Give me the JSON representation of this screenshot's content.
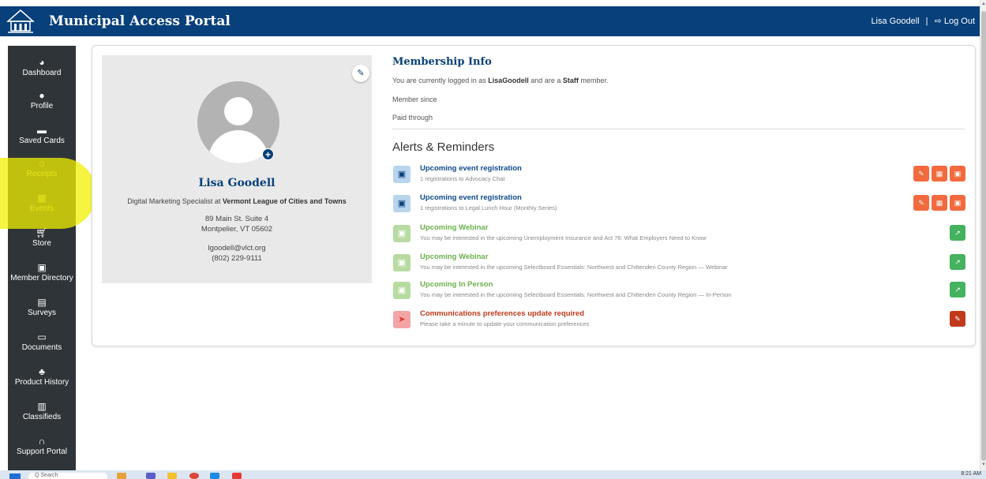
{
  "header": {
    "title": "Municipal Access Portal",
    "user_name": "Lisa Goodell",
    "separator": "|",
    "logout_label": "Log Out"
  },
  "sidebar": {
    "items": [
      {
        "label": "Dashboard",
        "icon": "dashboard-icon"
      },
      {
        "label": "Profile",
        "icon": "user-icon"
      },
      {
        "label": "Saved Cards",
        "icon": "card-icon"
      },
      {
        "label": "Receipts",
        "icon": "bank-icon"
      },
      {
        "label": "Events",
        "icon": "calendar-icon"
      },
      {
        "label": "Store",
        "icon": "cart-icon"
      },
      {
        "label": "Member Directory",
        "icon": "contact-icon"
      },
      {
        "label": "Surveys",
        "icon": "survey-icon"
      },
      {
        "label": "Documents",
        "icon": "folder-icon"
      },
      {
        "label": "Product History",
        "icon": "cubes-icon"
      },
      {
        "label": "Classifieds",
        "icon": "newspaper-icon"
      },
      {
        "label": "Support Portal",
        "icon": "headset-icon"
      }
    ]
  },
  "profile": {
    "name": "Lisa Goodell",
    "title_prefix": "Digital Marketing Specialist at",
    "organization": "Vermont League of Cities and Towns",
    "address_line1": "89 Main St. Suite 4",
    "address_line2": "Montpelier, VT 05602",
    "email": "lgoodell@vlct.org",
    "phone": "(802) 229-9111"
  },
  "membership": {
    "title": "Membership Info",
    "logged_in_prefix": "You are currently logged in as",
    "username": "LisaGoodell",
    "logged_in_mid": "and are a",
    "member_type": "Staff",
    "logged_in_suffix": "member.",
    "member_since_label": "Member since",
    "paid_through_label": "Paid through"
  },
  "alerts": {
    "title": "Alerts & Reminders",
    "items": [
      {
        "title": "Upcoming event registration",
        "subtitle": "1 registrations to Advocacy Chat"
      },
      {
        "title": "Upcoming event registration",
        "subtitle": "1 registrations to Legal Lunch Hour (Monthly Series)"
      },
      {
        "title": "Upcoming Webinar",
        "subtitle": "You may be interested in the upcoming Unemployment Insurance and Act 76: What Employers Need to Know"
      },
      {
        "title": "Upcoming Webinar",
        "subtitle": "You may be interested in the upcoming Selectboard Essentials: Northwest and Chittenden County Region — Webinar"
      },
      {
        "title": "Upcoming In Person",
        "subtitle": "You may be interested in the upcoming Selectboard Essentials: Northwest and Chittenden County Region — In-Person"
      },
      {
        "title": "Communications preferences update required",
        "subtitle": "Please take a minute to update your communication preferences"
      }
    ]
  },
  "taskbar": {
    "search_placeholder": "Q Search",
    "time": "8:21 AM"
  },
  "colors": {
    "brand": "#07407a",
    "sidebar": "#2f3438",
    "orange": "#f26a3d",
    "green": "#44b25e",
    "red": "#c0391b"
  }
}
